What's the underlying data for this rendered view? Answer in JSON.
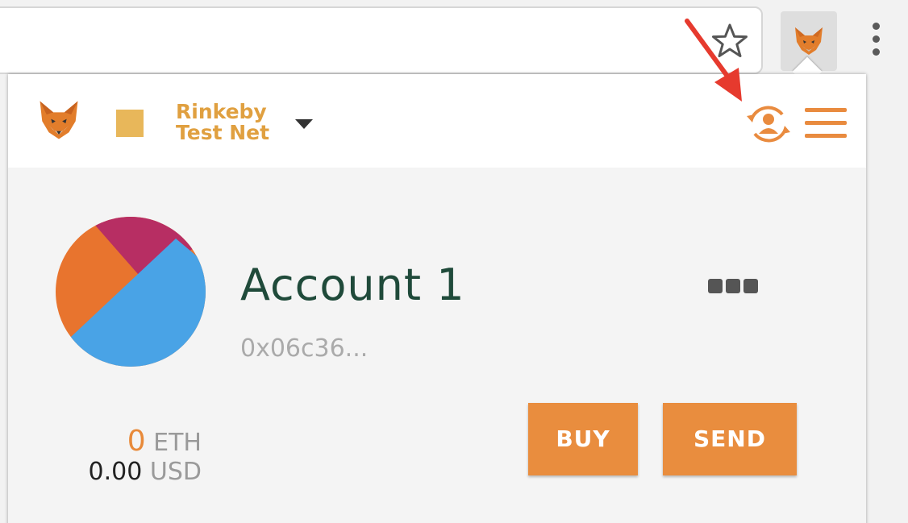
{
  "browser": {
    "bookmark_icon": "star-outline-icon",
    "extension_icon": "metamask-fox-icon",
    "menu_icon": "kebab-menu-icon"
  },
  "header": {
    "logo_icon": "metamask-fox-icon",
    "network": {
      "line1": "Rinkeby",
      "line2": "Test Net",
      "color": "#e8b75a",
      "dropdown_icon": "caret-down-icon"
    },
    "account_switch_icon": "account-switch-icon",
    "menu_icon": "hamburger-menu-icon",
    "accent_color": "#e98b3f"
  },
  "account": {
    "name": "Account 1",
    "address": "0x06c36...",
    "identicon_colors": [
      "#e8742e",
      "#49a3e6",
      "#b72e63",
      "#e7b344"
    ],
    "menu_icon": "more-dots-icon"
  },
  "balance": {
    "eth_amount": "0",
    "eth_unit": "ETH",
    "usd_amount": "0.00",
    "usd_unit": "USD"
  },
  "actions": {
    "buy_label": "BUY",
    "send_label": "SEND",
    "button_color": "#e98d3e"
  },
  "annotation": {
    "arrow_icon": "red-arrow-icon",
    "color": "#e63a2e"
  }
}
